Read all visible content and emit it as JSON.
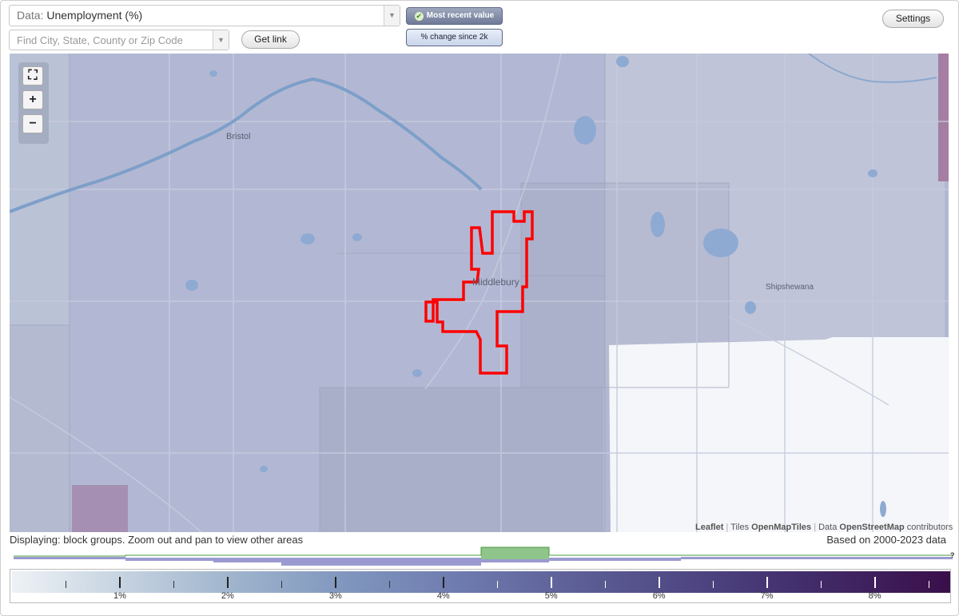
{
  "data_select": {
    "prefix": "Data:",
    "value": "Unemployment (%)"
  },
  "search": {
    "placeholder": "Find City, State, County or Zip Code"
  },
  "buttons": {
    "get_link": "Get link",
    "settings": "Settings"
  },
  "toggles": {
    "most_recent": "Most recent value",
    "percent_change": "% change since 2k"
  },
  "map": {
    "places": [
      "Bristol",
      "Middlebury",
      "Shipshewana"
    ],
    "attribution": {
      "leaflet": "Leaflet",
      "tiles_prefix": "Tiles",
      "tiles": "OpenMapTiles",
      "data_prefix": "Data",
      "data": "OpenStreetMap",
      "data_suffix": "contributors"
    },
    "highlight_color": "#ff0000"
  },
  "footer": {
    "displaying": "Displaying: block groups. Zoom out and pan to view other areas",
    "based_on": "Based on 2000-2023 data",
    "histogram_help": "?"
  },
  "legend": {
    "labels": [
      "1%",
      "2%",
      "3%",
      "4%",
      "5%",
      "6%",
      "7%",
      "8%"
    ],
    "min": 0,
    "max": 8.7
  }
}
